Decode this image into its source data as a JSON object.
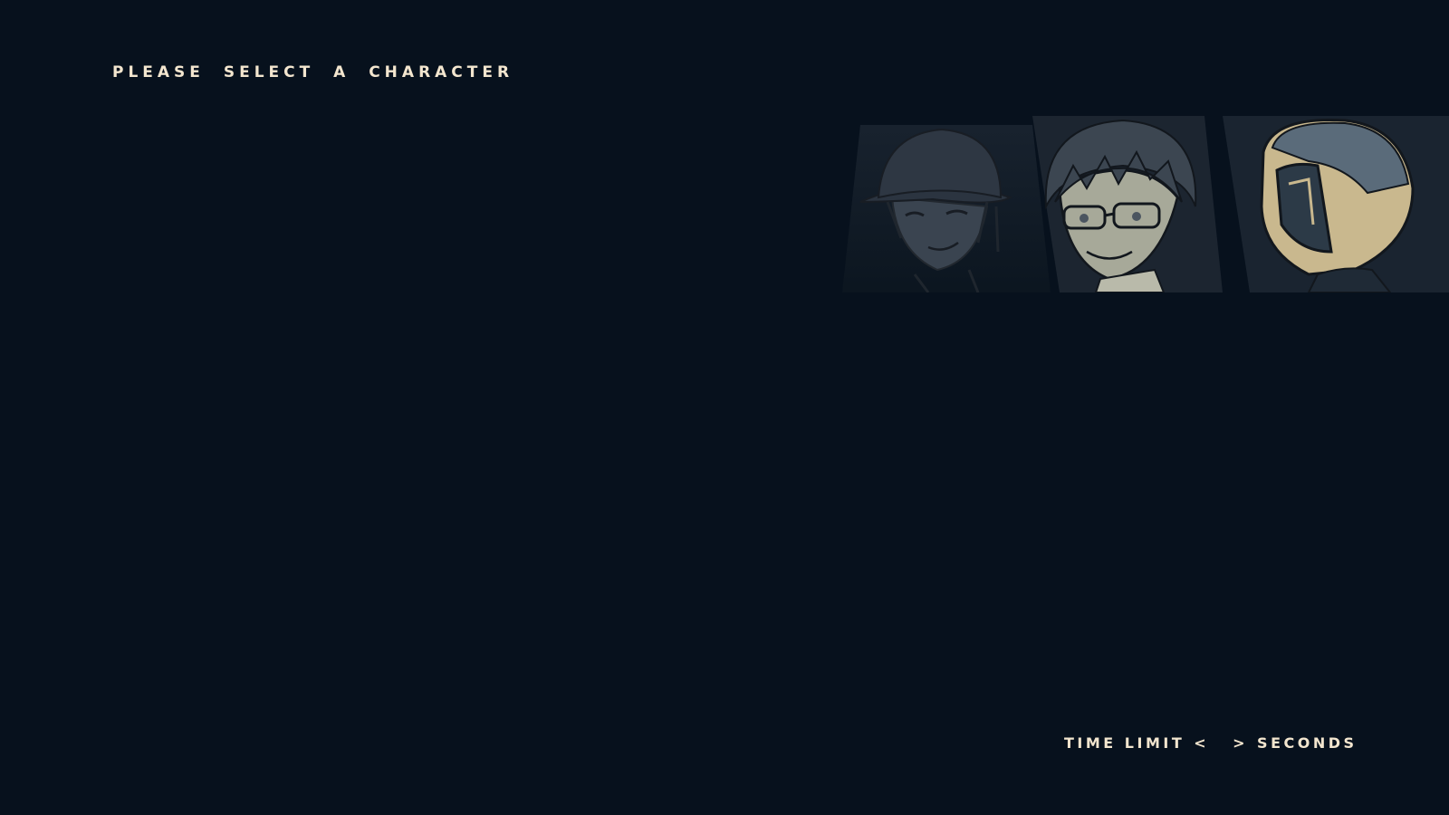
{
  "screen": {
    "background": "#07111d",
    "text_color": "#f3e6cf"
  },
  "prompt": {
    "text": "PLEASE SELECT A CHARACTER"
  },
  "characters": [
    {
      "icon": "hat-character-portrait",
      "state": "dimmed"
    },
    {
      "icon": "glasses-character-portrait",
      "state": "highlighted"
    },
    {
      "icon": "helmet-character-portrait",
      "state": "normal"
    }
  ],
  "time_limit": {
    "label": "TIME LIMIT",
    "left_arrow": "<",
    "value": "",
    "right_arrow": ">",
    "unit": "SECONDS"
  }
}
